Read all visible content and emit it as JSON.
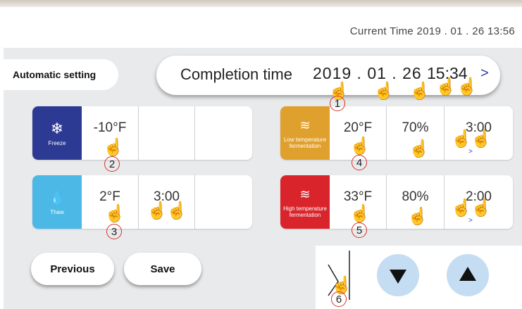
{
  "header": {
    "current_time_label": "Current Time",
    "current_time_value": "2019 . 01 . 26  13:56"
  },
  "mode_tab": {
    "label": "Automatic setting"
  },
  "completion": {
    "label": "Completion time",
    "date": "2019 . 01 . 26",
    "time": "15:34",
    "chevron": ">"
  },
  "rows": {
    "freeze": {
      "icon": "snowflake-icon",
      "icon_glyph": "❄",
      "label": "Freeze",
      "color": "#2d3a94",
      "temp": "-10°F",
      "time": ""
    },
    "thaw": {
      "icon": "water-drop-icon",
      "icon_glyph": "💧",
      "label": "Thaw",
      "color": "#4bb8e6",
      "temp": "2°F",
      "time": "3:00"
    },
    "low": {
      "icon": "bread-icon",
      "icon_glyph": "≋",
      "label": "Low temperature fermentation",
      "color": "#e0a02e",
      "temp": "20°F",
      "humidity": "70%",
      "time": "3:00"
    },
    "high": {
      "icon": "bread-icon",
      "icon_glyph": "≋",
      "label": "High temperature fermentation",
      "color": "#d9242b",
      "temp": "33°F",
      "humidity": "80%",
      "time": "2:00"
    }
  },
  "buttons": {
    "previous": "Previous",
    "save": "Save"
  },
  "step_numbers": [
    "1",
    "2",
    "3",
    "4",
    "5",
    "6"
  ],
  "accent_colors": {
    "panel": "#e9eaec",
    "nav_buttons": "#c4ddf2",
    "callout_circle": "#d6332a",
    "chevron": "#2a3aa8"
  }
}
